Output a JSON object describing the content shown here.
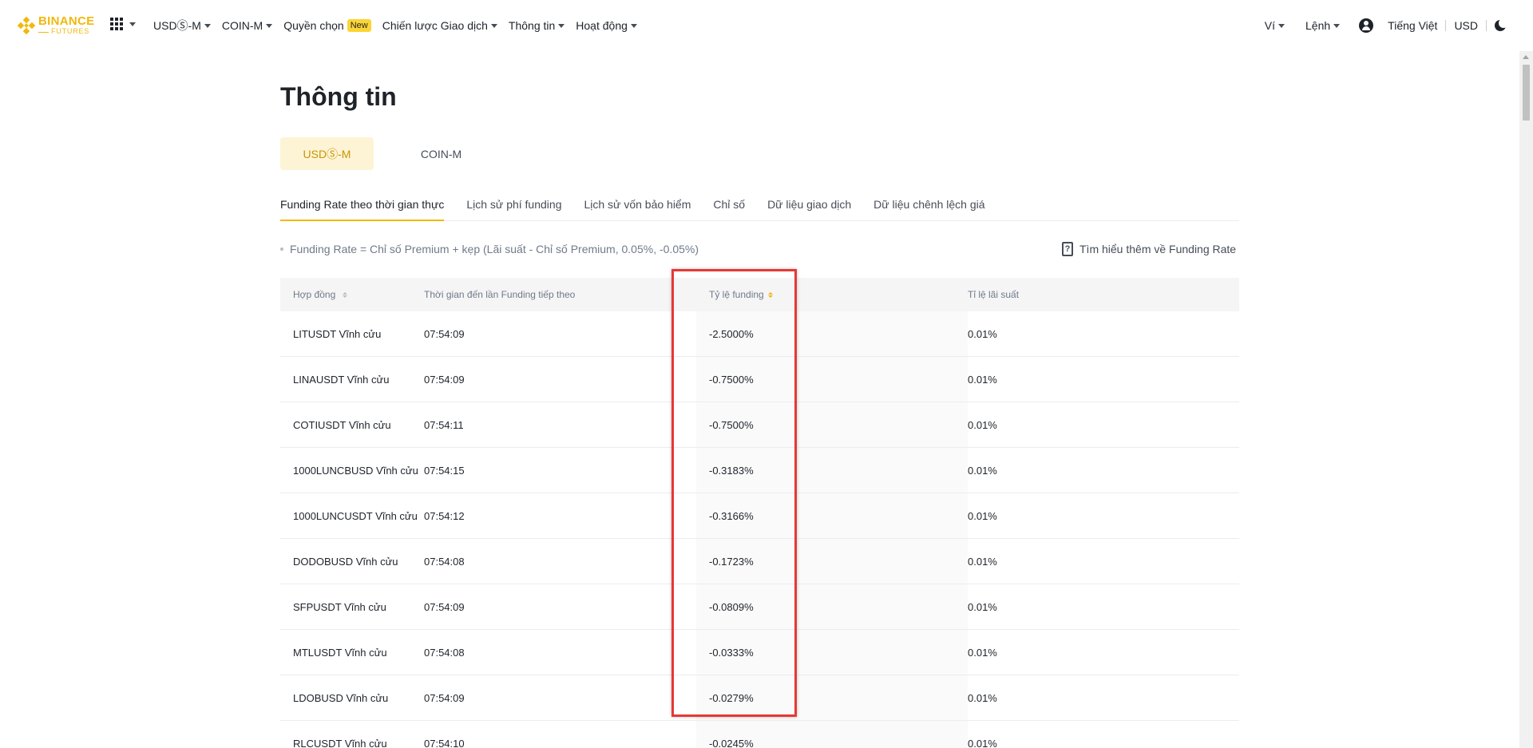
{
  "logo": {
    "line1": "BINANCE",
    "line2": "FUTURES"
  },
  "nav": {
    "items": [
      {
        "label": "USDⓈ-M",
        "dropdown": true
      },
      {
        "label": "COIN-M",
        "dropdown": true
      },
      {
        "label": "Quyền chọn",
        "badge": "New",
        "dropdown": false
      },
      {
        "label": "Chiến lược Giao dịch",
        "dropdown": true
      },
      {
        "label": "Thông tin",
        "dropdown": true
      },
      {
        "label": "Hoạt động",
        "dropdown": true
      }
    ],
    "right": {
      "wallet": "Ví",
      "orders": "Lệnh",
      "language": "Tiếng Việt",
      "currency": "USD"
    }
  },
  "page": {
    "title": "Thông tin",
    "segments": [
      "USDⓈ-M",
      "COIN-M"
    ],
    "active_segment": 0,
    "tabs": [
      "Funding Rate theo thời gian thực",
      "Lịch sử phí funding",
      "Lịch sử vốn bảo hiểm",
      "Chỉ số",
      "Dữ liệu giao dịch",
      "Dữ liệu chênh lệch giá"
    ],
    "active_tab": 0,
    "formula": "Funding Rate = Chỉ số Premium + kẹp (Lãi suất - Chỉ số Premium, 0.05%, -0.05%)",
    "learn_more": "Tìm hiểu thêm về Funding Rate"
  },
  "table": {
    "headers": {
      "contract": "Hợp đồng",
      "next_funding": "Thời gian đến lần Funding tiếp theo",
      "funding_rate": "Tỷ lệ funding",
      "interest_rate": "Tỉ lệ lãi suất"
    },
    "rows": [
      {
        "contract": "LITUSDT Vĩnh cửu",
        "time": "07:54:09",
        "rate": "-2.5000%",
        "interest": "0.01%"
      },
      {
        "contract": "LINAUSDT Vĩnh cửu",
        "time": "07:54:09",
        "rate": "-0.7500%",
        "interest": "0.01%"
      },
      {
        "contract": "COTIUSDT Vĩnh cửu",
        "time": "07:54:11",
        "rate": "-0.7500%",
        "interest": "0.01%"
      },
      {
        "contract": "1000LUNCBUSD Vĩnh cửu",
        "time": "07:54:15",
        "rate": "-0.3183%",
        "interest": "0.01%"
      },
      {
        "contract": "1000LUNCUSDT Vĩnh cửu",
        "time": "07:54:12",
        "rate": "-0.3166%",
        "interest": "0.01%"
      },
      {
        "contract": "DODOBUSD Vĩnh cửu",
        "time": "07:54:08",
        "rate": "-0.1723%",
        "interest": "0.01%"
      },
      {
        "contract": "SFPUSDT Vĩnh cửu",
        "time": "07:54:09",
        "rate": "-0.0809%",
        "interest": "0.01%"
      },
      {
        "contract": "MTLUSDT Vĩnh cửu",
        "time": "07:54:08",
        "rate": "-0.0333%",
        "interest": "0.01%"
      },
      {
        "contract": "LDOBUSD Vĩnh cửu",
        "time": "07:54:09",
        "rate": "-0.0279%",
        "interest": "0.01%"
      },
      {
        "contract": "RLCUSDT Vĩnh cửu",
        "time": "07:54:10",
        "rate": "-0.0245%",
        "interest": "0.01%"
      }
    ]
  },
  "colors": {
    "brand": "#f0b90b",
    "highlight": "#e53935",
    "active_segment_bg": "#fdf4d5"
  }
}
